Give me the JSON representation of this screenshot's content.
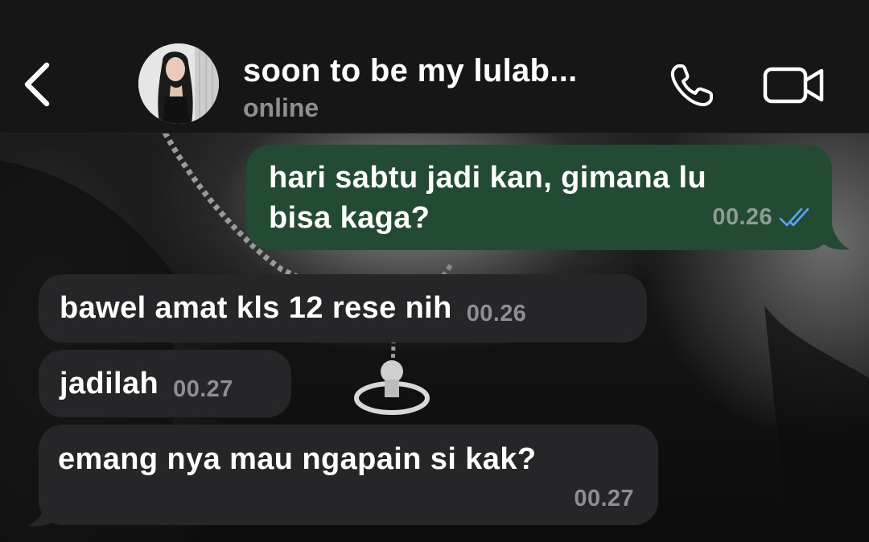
{
  "header": {
    "contact_name": "soon to be my lulab...",
    "status": "online",
    "icons": {
      "back": "chevron-left-icon",
      "call": "phone-icon",
      "video": "video-camera-icon"
    }
  },
  "messages": [
    {
      "direction": "outgoing",
      "line1": "hari sabtu jadi kan, gimana lu",
      "line2": "bisa kaga?",
      "time": "00.26",
      "receipt": "double-check-read"
    },
    {
      "direction": "incoming",
      "text": "bawel amat kls 12 rese nih",
      "time": "00.26"
    },
    {
      "direction": "incoming",
      "text": "jadilah",
      "time": "00.27"
    },
    {
      "direction": "incoming",
      "text": "emang nya mau ngapain si kak?",
      "time": "00.27"
    }
  ],
  "colors": {
    "outgoing_bubble": "#234b33",
    "incoming_bubble": "#262628",
    "header_bg": "#161616",
    "read_receipt": "#5aa3ff",
    "muted_text": "#8e8e93"
  }
}
